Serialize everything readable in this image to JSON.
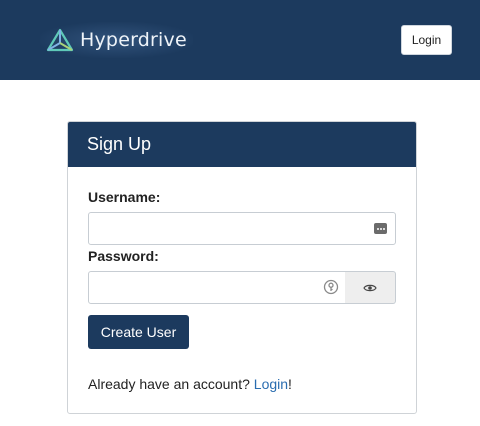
{
  "header": {
    "brand_name": "Hyperdrive",
    "logo_icon": "triangle-logo-icon",
    "login_button": "Login",
    "colors": {
      "bar": "#1c3a5e",
      "logo_accent": "#5fc9b8"
    }
  },
  "signup": {
    "title": "Sign Up",
    "username_label": "Username:",
    "username_value": "",
    "username_icon": "password-manager-dots-icon",
    "password_label": "Password:",
    "password_value": "",
    "password_icon": "key-autofill-icon",
    "toggle_visibility_icon": "eye-icon",
    "create_button": "Create User",
    "footer_prefix": "Already have an account? ",
    "footer_link": "Login",
    "footer_suffix": "!",
    "colors": {
      "header": "#1c3a5e",
      "button": "#1c3a5e",
      "link": "#2a6db0"
    }
  }
}
